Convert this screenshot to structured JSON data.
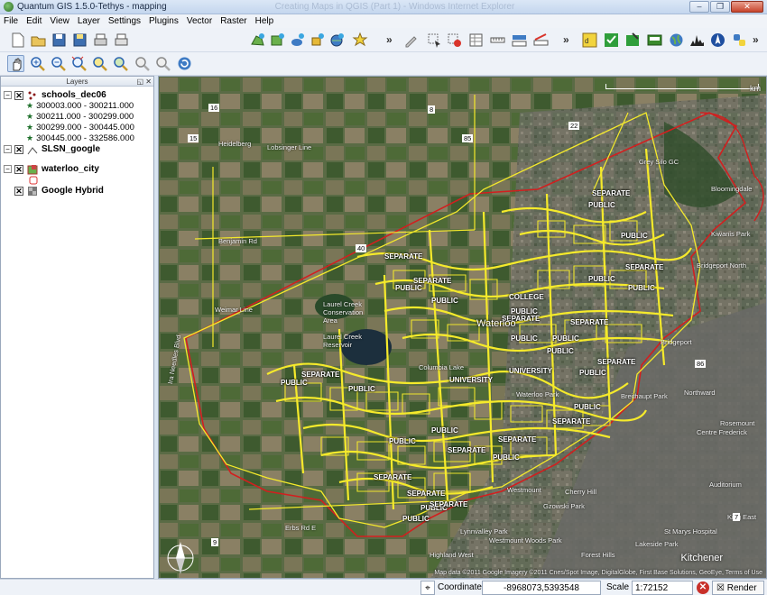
{
  "window": {
    "title": "Quantum GIS 1.5.0-Tethys - mapping",
    "blurred_caption": "Creating Maps in QGIS (Part 1) - Windows Internet Explorer",
    "controls": [
      "–",
      "❐",
      "✕"
    ]
  },
  "menu": [
    "File",
    "Edit",
    "View",
    "Layer",
    "Settings",
    "Plugins",
    "Vector",
    "Raster",
    "Help"
  ],
  "layers_panel": {
    "title": "Layers",
    "buttons": "◱ ✕",
    "items": [
      {
        "name": "schools_dec06",
        "expanded": true,
        "classes": [
          "300003.000 - 300211.000",
          "300211.000 - 300299.000",
          "300299.000 - 300445.000",
          "300445.000 - 332586.000"
        ]
      },
      {
        "name": "SLSN_google"
      },
      {
        "name": "waterloo_city",
        "expanded": true
      },
      {
        "name": "Google Hybrid"
      }
    ]
  },
  "map": {
    "scalebar_label": "km",
    "labels": [
      "SEPARATE",
      "PUBLIC",
      "SEPARATE",
      "PUBLIC",
      "PUBLIC",
      "SEPARATE",
      "PUBLIC",
      "PUBLIC",
      "SEPARATE",
      "PUBLIC",
      "COLLEGE",
      "SEPARATE",
      "PUBLIC",
      "SEPARATE",
      "PUBLIC",
      "SEPARATE",
      "UNIVERSITY",
      "UNIVERSITY",
      "PUBLIC",
      "SEPARATE",
      "PUBLIC",
      "PUBLIC",
      "SEPARATE",
      "PUBLIC",
      "PUBLIC",
      "SEPARATE",
      "PUBLIC",
      "PUBLIC",
      "SEPARATE",
      "PUBLIC",
      "SEPARATE",
      "PUBLIC",
      "PUBLIC",
      "SEPARATE",
      "PUBLIC",
      "SEPARATE"
    ],
    "places": [
      "Heidelberg",
      "Laurel Creek Conservation Area",
      "Laurel Creek Reservoir",
      "Waterloo",
      "Bridgeport North",
      "Bridgeport",
      "Rosemount",
      "Northward",
      "Breithaupt Park",
      "Westmount",
      "Cherry Hill",
      "Forest Hills",
      "Highland West",
      "Kiwanis Park",
      "Bloomingdale",
      "Grey Silo GC",
      "Waterloo Park",
      "Columbia Lake",
      "Gzowski Park",
      "Lynnvalley Park",
      "Westmount Woods Park",
      "St Marys Hospital",
      "Lakeside Park",
      "Auditorium",
      "King East",
      "Centre Frederick"
    ],
    "roads": [
      "16",
      "15",
      "8",
      "85",
      "22",
      "40",
      "9",
      "86",
      "7"
    ],
    "road_names": [
      "Lobsinger Line",
      "Benjamin Rd",
      "Erbs Rd E",
      "Weimar Line",
      "Ira Needles Blvd"
    ],
    "city": "Kitchener",
    "attribution": "Map data ©2011 Google Imagery ©2011 Cnes/Spot Image, DigitalGlobe, First Base Solutions, GeoEye, Terms of Use"
  },
  "status": {
    "coordinate_label": "Coordinate:",
    "coordinate_value": "-8968073,5393548",
    "scale_label": "Scale",
    "scale_value": "1:72152",
    "render_label": "Render"
  }
}
